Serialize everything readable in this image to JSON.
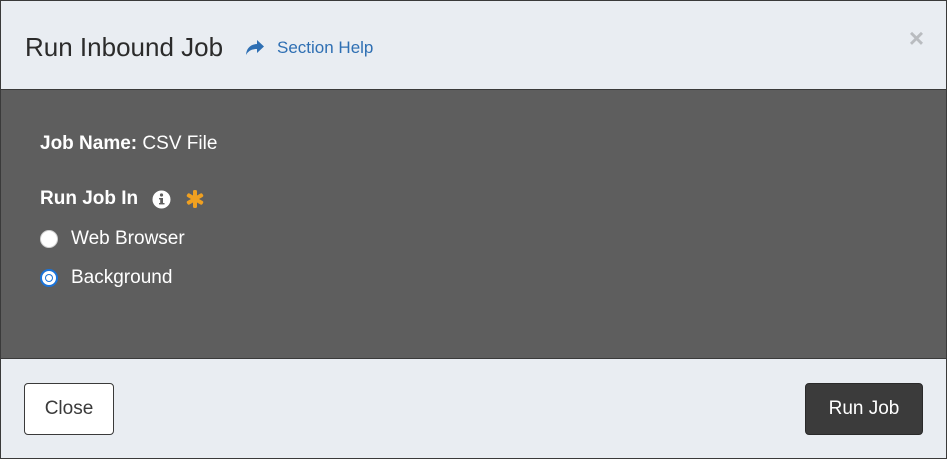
{
  "dialog": {
    "title": "Run Inbound Job",
    "help_link": "Section Help",
    "close_symbol": "×"
  },
  "body": {
    "job_name_label": "Job Name:",
    "job_name_value": "CSV File",
    "run_in_label": "Run Job In",
    "info_icon": "info-circle-icon",
    "required_icon": "asterisk-icon",
    "required_color": "#f0a020",
    "options": [
      {
        "label": "Web Browser",
        "selected": false
      },
      {
        "label": "Background",
        "selected": true
      }
    ]
  },
  "footer": {
    "close_label": "Close",
    "run_label": "Run Job"
  },
  "colors": {
    "header_bg": "#e9edf2",
    "body_bg": "#5e5e5e",
    "link": "#2e6fb3",
    "primary_button": "#3b3b3b",
    "radio_accent": "#1a73d9"
  }
}
